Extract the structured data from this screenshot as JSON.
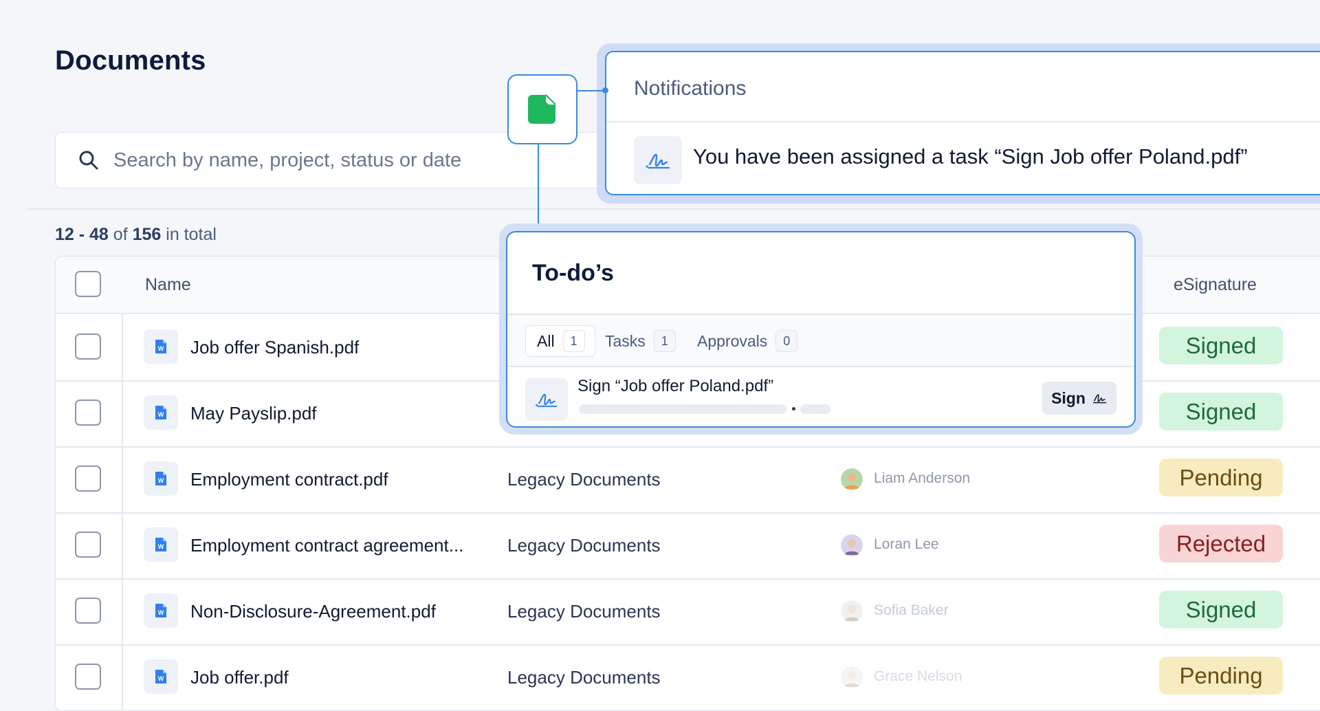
{
  "page": {
    "title": "Documents"
  },
  "search": {
    "placeholder": "Search by name, project, status or date"
  },
  "pagination": {
    "range": "12 - 48",
    "of": "of",
    "total": "156",
    "suffix": "in total"
  },
  "table": {
    "columns": {
      "name": "Name",
      "esignature": "eSignature"
    },
    "rows": [
      {
        "name": "Job offer Spanish.pdf",
        "project": "",
        "person": "",
        "status": "Signed"
      },
      {
        "name": "May Payslip.pdf",
        "project": "",
        "person": "",
        "status": "Signed"
      },
      {
        "name": "Employment contract.pdf",
        "project": "Legacy Documents",
        "person": "Liam Anderson",
        "status": "Pending"
      },
      {
        "name": "Employment contract agreement...",
        "project": "Legacy Documents",
        "person": "Loran Lee",
        "status": "Rejected"
      },
      {
        "name": "Non-Disclosure-Agreement.pdf",
        "project": "Legacy Documents",
        "person": "Sofia Baker",
        "status": "Signed"
      },
      {
        "name": "Job offer.pdf",
        "project": "Legacy Documents",
        "person": "Grace Nelson",
        "status": "Pending"
      }
    ]
  },
  "notifications": {
    "title": "Notifications",
    "message": "You have been assigned a task “Sign Job offer Poland.pdf”"
  },
  "todos": {
    "title": "To-do’s",
    "tabs": [
      {
        "label": "All",
        "count": "1"
      },
      {
        "label": "Tasks",
        "count": "1"
      },
      {
        "label": "Approvals",
        "count": "0"
      }
    ],
    "task": {
      "title": "Sign “Job offer Poland.pdf”",
      "button": "Sign"
    }
  },
  "colors": {
    "accent": "#3a8bdf",
    "app_icon": "#1fb85e",
    "signed_bg": "#d3f5de",
    "pending_bg": "#f8ebc0",
    "rejected_bg": "#f9d4d4"
  }
}
